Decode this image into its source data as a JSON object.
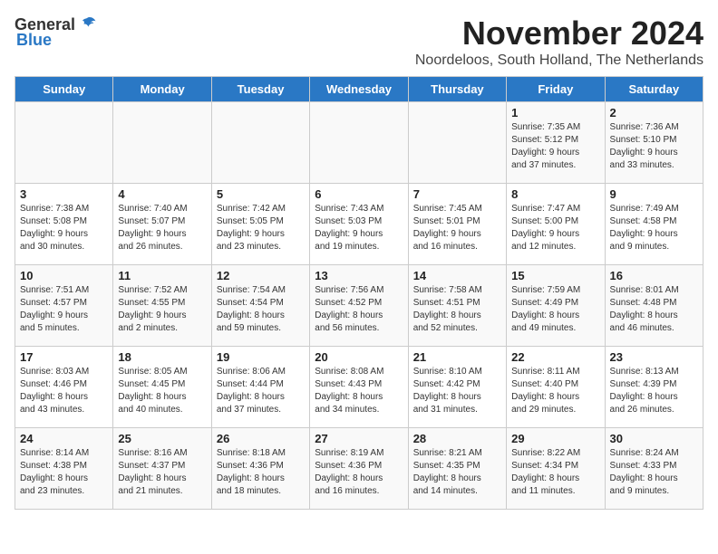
{
  "header": {
    "logo_general": "General",
    "logo_blue": "Blue",
    "month_title": "November 2024",
    "subtitle": "Noordeloos, South Holland, The Netherlands"
  },
  "days_of_week": [
    "Sunday",
    "Monday",
    "Tuesday",
    "Wednesday",
    "Thursday",
    "Friday",
    "Saturday"
  ],
  "weeks": [
    [
      {
        "day": "",
        "info": ""
      },
      {
        "day": "",
        "info": ""
      },
      {
        "day": "",
        "info": ""
      },
      {
        "day": "",
        "info": ""
      },
      {
        "day": "",
        "info": ""
      },
      {
        "day": "1",
        "info": "Sunrise: 7:35 AM\nSunset: 5:12 PM\nDaylight: 9 hours\nand 37 minutes."
      },
      {
        "day": "2",
        "info": "Sunrise: 7:36 AM\nSunset: 5:10 PM\nDaylight: 9 hours\nand 33 minutes."
      }
    ],
    [
      {
        "day": "3",
        "info": "Sunrise: 7:38 AM\nSunset: 5:08 PM\nDaylight: 9 hours\nand 30 minutes."
      },
      {
        "day": "4",
        "info": "Sunrise: 7:40 AM\nSunset: 5:07 PM\nDaylight: 9 hours\nand 26 minutes."
      },
      {
        "day": "5",
        "info": "Sunrise: 7:42 AM\nSunset: 5:05 PM\nDaylight: 9 hours\nand 23 minutes."
      },
      {
        "day": "6",
        "info": "Sunrise: 7:43 AM\nSunset: 5:03 PM\nDaylight: 9 hours\nand 19 minutes."
      },
      {
        "day": "7",
        "info": "Sunrise: 7:45 AM\nSunset: 5:01 PM\nDaylight: 9 hours\nand 16 minutes."
      },
      {
        "day": "8",
        "info": "Sunrise: 7:47 AM\nSunset: 5:00 PM\nDaylight: 9 hours\nand 12 minutes."
      },
      {
        "day": "9",
        "info": "Sunrise: 7:49 AM\nSunset: 4:58 PM\nDaylight: 9 hours\nand 9 minutes."
      }
    ],
    [
      {
        "day": "10",
        "info": "Sunrise: 7:51 AM\nSunset: 4:57 PM\nDaylight: 9 hours\nand 5 minutes."
      },
      {
        "day": "11",
        "info": "Sunrise: 7:52 AM\nSunset: 4:55 PM\nDaylight: 9 hours\nand 2 minutes."
      },
      {
        "day": "12",
        "info": "Sunrise: 7:54 AM\nSunset: 4:54 PM\nDaylight: 8 hours\nand 59 minutes."
      },
      {
        "day": "13",
        "info": "Sunrise: 7:56 AM\nSunset: 4:52 PM\nDaylight: 8 hours\nand 56 minutes."
      },
      {
        "day": "14",
        "info": "Sunrise: 7:58 AM\nSunset: 4:51 PM\nDaylight: 8 hours\nand 52 minutes."
      },
      {
        "day": "15",
        "info": "Sunrise: 7:59 AM\nSunset: 4:49 PM\nDaylight: 8 hours\nand 49 minutes."
      },
      {
        "day": "16",
        "info": "Sunrise: 8:01 AM\nSunset: 4:48 PM\nDaylight: 8 hours\nand 46 minutes."
      }
    ],
    [
      {
        "day": "17",
        "info": "Sunrise: 8:03 AM\nSunset: 4:46 PM\nDaylight: 8 hours\nand 43 minutes."
      },
      {
        "day": "18",
        "info": "Sunrise: 8:05 AM\nSunset: 4:45 PM\nDaylight: 8 hours\nand 40 minutes."
      },
      {
        "day": "19",
        "info": "Sunrise: 8:06 AM\nSunset: 4:44 PM\nDaylight: 8 hours\nand 37 minutes."
      },
      {
        "day": "20",
        "info": "Sunrise: 8:08 AM\nSunset: 4:43 PM\nDaylight: 8 hours\nand 34 minutes."
      },
      {
        "day": "21",
        "info": "Sunrise: 8:10 AM\nSunset: 4:42 PM\nDaylight: 8 hours\nand 31 minutes."
      },
      {
        "day": "22",
        "info": "Sunrise: 8:11 AM\nSunset: 4:40 PM\nDaylight: 8 hours\nand 29 minutes."
      },
      {
        "day": "23",
        "info": "Sunrise: 8:13 AM\nSunset: 4:39 PM\nDaylight: 8 hours\nand 26 minutes."
      }
    ],
    [
      {
        "day": "24",
        "info": "Sunrise: 8:14 AM\nSunset: 4:38 PM\nDaylight: 8 hours\nand 23 minutes."
      },
      {
        "day": "25",
        "info": "Sunrise: 8:16 AM\nSunset: 4:37 PM\nDaylight: 8 hours\nand 21 minutes."
      },
      {
        "day": "26",
        "info": "Sunrise: 8:18 AM\nSunset: 4:36 PM\nDaylight: 8 hours\nand 18 minutes."
      },
      {
        "day": "27",
        "info": "Sunrise: 8:19 AM\nSunset: 4:36 PM\nDaylight: 8 hours\nand 16 minutes."
      },
      {
        "day": "28",
        "info": "Sunrise: 8:21 AM\nSunset: 4:35 PM\nDaylight: 8 hours\nand 14 minutes."
      },
      {
        "day": "29",
        "info": "Sunrise: 8:22 AM\nSunset: 4:34 PM\nDaylight: 8 hours\nand 11 minutes."
      },
      {
        "day": "30",
        "info": "Sunrise: 8:24 AM\nSunset: 4:33 PM\nDaylight: 8 hours\nand 9 minutes."
      }
    ]
  ]
}
